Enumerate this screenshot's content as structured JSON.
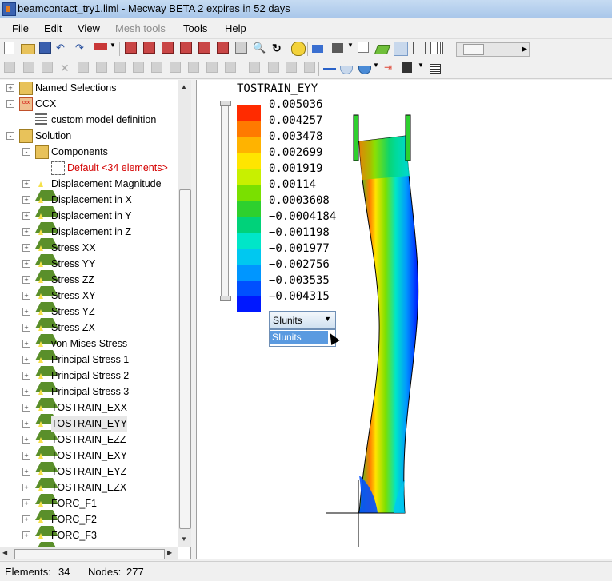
{
  "window": {
    "title": "beamcontact_try1.liml - Mecway BETA 2 expires in 52 days"
  },
  "menu": {
    "file": "File",
    "edit": "Edit",
    "view": "View",
    "mesh_tools": "Mesh tools",
    "tools": "Tools",
    "help": "Help"
  },
  "tree": {
    "items": [
      {
        "label": "Named Selections",
        "icon": "folder-icon",
        "expander": "+"
      },
      {
        "label": "CCX",
        "icon": "ccx-icon",
        "expander": "-"
      },
      {
        "label": "custom model definition",
        "icon": "custom-model-icon",
        "expander": ""
      },
      {
        "label": "Solution",
        "icon": "solution-icon",
        "expander": "-"
      },
      {
        "label": "Components",
        "icon": "folder-icon",
        "expander": "-"
      },
      {
        "label": "Default <34 elements>",
        "icon": "component-icon",
        "expander": "",
        "highlight": "red"
      },
      {
        "label": "Displacement Magnitude",
        "icon": "result-icon",
        "expander": "+"
      },
      {
        "label": "Displacement in X",
        "icon": "result-icon",
        "expander": "+"
      },
      {
        "label": "Displacement in Y",
        "icon": "result-icon",
        "expander": "+"
      },
      {
        "label": "Displacement in Z",
        "icon": "result-icon",
        "expander": "+"
      },
      {
        "label": "Stress XX",
        "icon": "result-icon",
        "expander": "+"
      },
      {
        "label": "Stress YY",
        "icon": "result-icon",
        "expander": "+"
      },
      {
        "label": "Stress ZZ",
        "icon": "result-icon",
        "expander": "+"
      },
      {
        "label": "Stress XY",
        "icon": "result-icon",
        "expander": "+"
      },
      {
        "label": "Stress YZ",
        "icon": "result-icon",
        "expander": "+"
      },
      {
        "label": "Stress ZX",
        "icon": "result-icon",
        "expander": "+"
      },
      {
        "label": "von Mises Stress",
        "icon": "result-icon",
        "expander": "+"
      },
      {
        "label": "Principal Stress 1",
        "icon": "result-icon",
        "expander": "+"
      },
      {
        "label": "Principal Stress 2",
        "icon": "result-icon",
        "expander": "+"
      },
      {
        "label": "Principal Stress 3",
        "icon": "result-icon",
        "expander": "+"
      },
      {
        "label": "TOSTRAIN_EXX",
        "icon": "result-icon",
        "expander": "+"
      },
      {
        "label": "TOSTRAIN_EYY",
        "icon": "result-icon",
        "expander": "+",
        "selected": true
      },
      {
        "label": "TOSTRAIN_EZZ",
        "icon": "result-icon",
        "expander": "+"
      },
      {
        "label": "TOSTRAIN_EXY",
        "icon": "result-icon",
        "expander": "+"
      },
      {
        "label": "TOSTRAIN_EYZ",
        "icon": "result-icon",
        "expander": "+"
      },
      {
        "label": "TOSTRAIN_EZX",
        "icon": "result-icon",
        "expander": "+"
      },
      {
        "label": "FORC_F1",
        "icon": "result-icon",
        "expander": "+"
      },
      {
        "label": "FORC_F2",
        "icon": "result-icon",
        "expander": "+"
      },
      {
        "label": "FORC_F3",
        "icon": "result-icon",
        "expander": "+"
      }
    ]
  },
  "legend": {
    "title": "TOSTRAIN_EYY",
    "values": [
      "0.005036",
      "0.004257",
      "0.003478",
      "0.002699",
      "0.001919",
      "0.00114",
      "0.0003608",
      "−0.0004184",
      "−0.001198",
      "−0.001977",
      "−0.002756",
      "−0.003535",
      "−0.004315"
    ],
    "colors": [
      "#ff2b00",
      "#ff7a00",
      "#ffb300",
      "#ffe500",
      "#c8f000",
      "#7ae000",
      "#2ed02e",
      "#00d27a",
      "#00e6c8",
      "#00c8f0",
      "#0096ff",
      "#0050ff",
      "#0018ff"
    ]
  },
  "units_combo": {
    "value": "SIunits",
    "options": [
      "SIunits"
    ]
  },
  "status": {
    "elements_label": "Elements:",
    "elements_value": "34",
    "nodes_label": "Nodes:",
    "nodes_value": "277"
  }
}
